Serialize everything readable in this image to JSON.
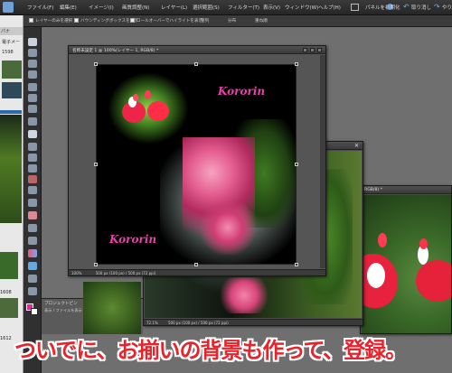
{
  "menubar": {
    "items": [
      "ファイル(F)",
      "編集(E)",
      "イメージ(I)",
      "画質調整(N)",
      "レイヤー(L)",
      "選択範囲(S)",
      "フィルター(T)",
      "表示(V)",
      "ウィンドウ(W)",
      "ヘルプ(H)"
    ],
    "panel_reset_label": "パネルを初期化",
    "undo_label": "取り消し",
    "redo_label": "やり"
  },
  "optbar": {
    "option1": "レイヤーのみを選択",
    "option2": "バウンディングボックスを表示",
    "option3": "ロールオーバーでハイライトを表示",
    "align_label": "整列",
    "distribute_label": "分布",
    "arrange_label": "重ね順"
  },
  "left_panel": {
    "tab_label": "パナ",
    "text1": "電子メー",
    "num1": "1598",
    "num2": "1608",
    "num3": "1612"
  },
  "doc_main": {
    "title": "名称未設定 1 @ 100%(レイヤー 1, RGB/8) *",
    "status_zoom": "100%",
    "status_info": "500 px (100 px) / 500 px (72 ppi)",
    "watermark_top": "Kororin",
    "watermark_bottom": "Kororin"
  },
  "doc_second": {
    "status_zoom": "72.1%",
    "status_info": "500 px (100 px) / 500 px (72 ppi)"
  },
  "doc_third": {
    "title_fragment": "RGB/8) *"
  },
  "project_bin": {
    "label": "プロジェクトビン",
    "sub": "表示 / ファイルを表示"
  },
  "caption": "ついでに、お揃いの背景も作って、登録。",
  "colors": {
    "caption_red": "#e8232c",
    "watermark_pink": "#e543a8",
    "ui_dark": "#2f2f2f"
  }
}
